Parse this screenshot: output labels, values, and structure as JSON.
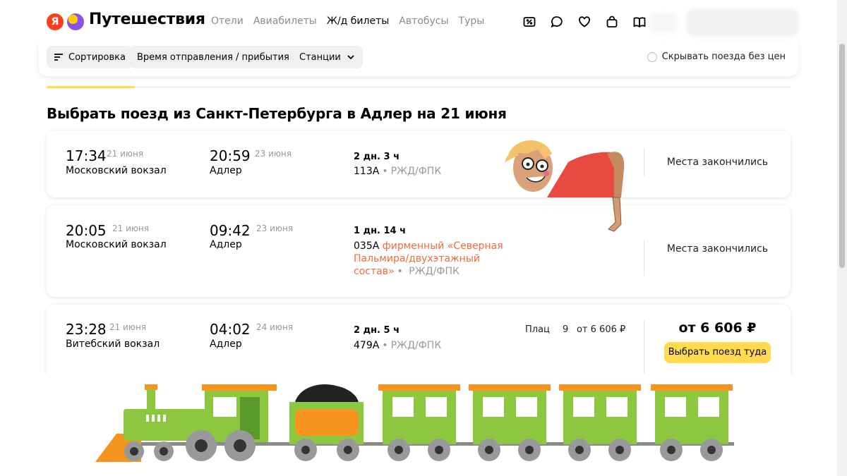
{
  "header": {
    "logo_mark": "Я",
    "brand": "Путешествия",
    "nav": [
      {
        "label": "Отели",
        "active": false
      },
      {
        "label": "Авиабилеты",
        "active": false
      },
      {
        "label": "Ж/д билеты",
        "active": true
      },
      {
        "label": "Автобусы",
        "active": false
      },
      {
        "label": "Туры",
        "active": false
      }
    ],
    "icons": [
      "discount-icon",
      "chat-icon",
      "heart-icon",
      "bag-icon",
      "book-icon"
    ]
  },
  "filters": {
    "sort_label": "Сортировка",
    "time_label": "Время отправления / прибытия",
    "stations_label": "Станции",
    "hide_no_price_label": "Скрывать поезда без цен"
  },
  "page": {
    "title": "Выбрать поезд из Санкт-Петербурга в Адлер на 21 июня"
  },
  "trains": [
    {
      "dep_time": "17:34",
      "dep_date": "21 июня",
      "dep_station": "Московский вокзал",
      "arr_time": "20:59",
      "arr_date": "23 июня",
      "arr_station": "Адлер",
      "duration": "2 дн. 3 ч",
      "number": "113А",
      "branded": "",
      "carrier": "РЖД/ФПК",
      "status": "Места закончились"
    },
    {
      "dep_time": "20:05",
      "dep_date": "21 июня",
      "dep_station": "Московский вокзал",
      "arr_time": "09:42",
      "arr_date": "23 июня",
      "arr_station": "Адлер",
      "duration": "1 дн. 14 ч",
      "number": "035А",
      "branded": "фирменный «Северная Пальмира/двухэтажный состав»",
      "carrier": "РЖД/ФПК",
      "status": "Места закончились"
    },
    {
      "dep_time": "23:28",
      "dep_date": "21 июня",
      "dep_station": "Витебский вокзал",
      "arr_time": "04:02",
      "arr_date": "24 июня",
      "arr_station": "Адлер",
      "duration": "2 дн. 5 ч",
      "number": "479А",
      "branded": "",
      "carrier": "РЖД/ФПК",
      "class_name": "Плац",
      "seats": "9",
      "class_price": "от 6 606 ₽",
      "price": "от 6 606 ₽",
      "select_label": "Выбрать поезд туда"
    }
  ],
  "colors": {
    "accent_yellow": "#ffdb4d",
    "branded_orange": "#f26b3a",
    "train_green": "#8dc63f",
    "train_orange": "#f7941d"
  }
}
